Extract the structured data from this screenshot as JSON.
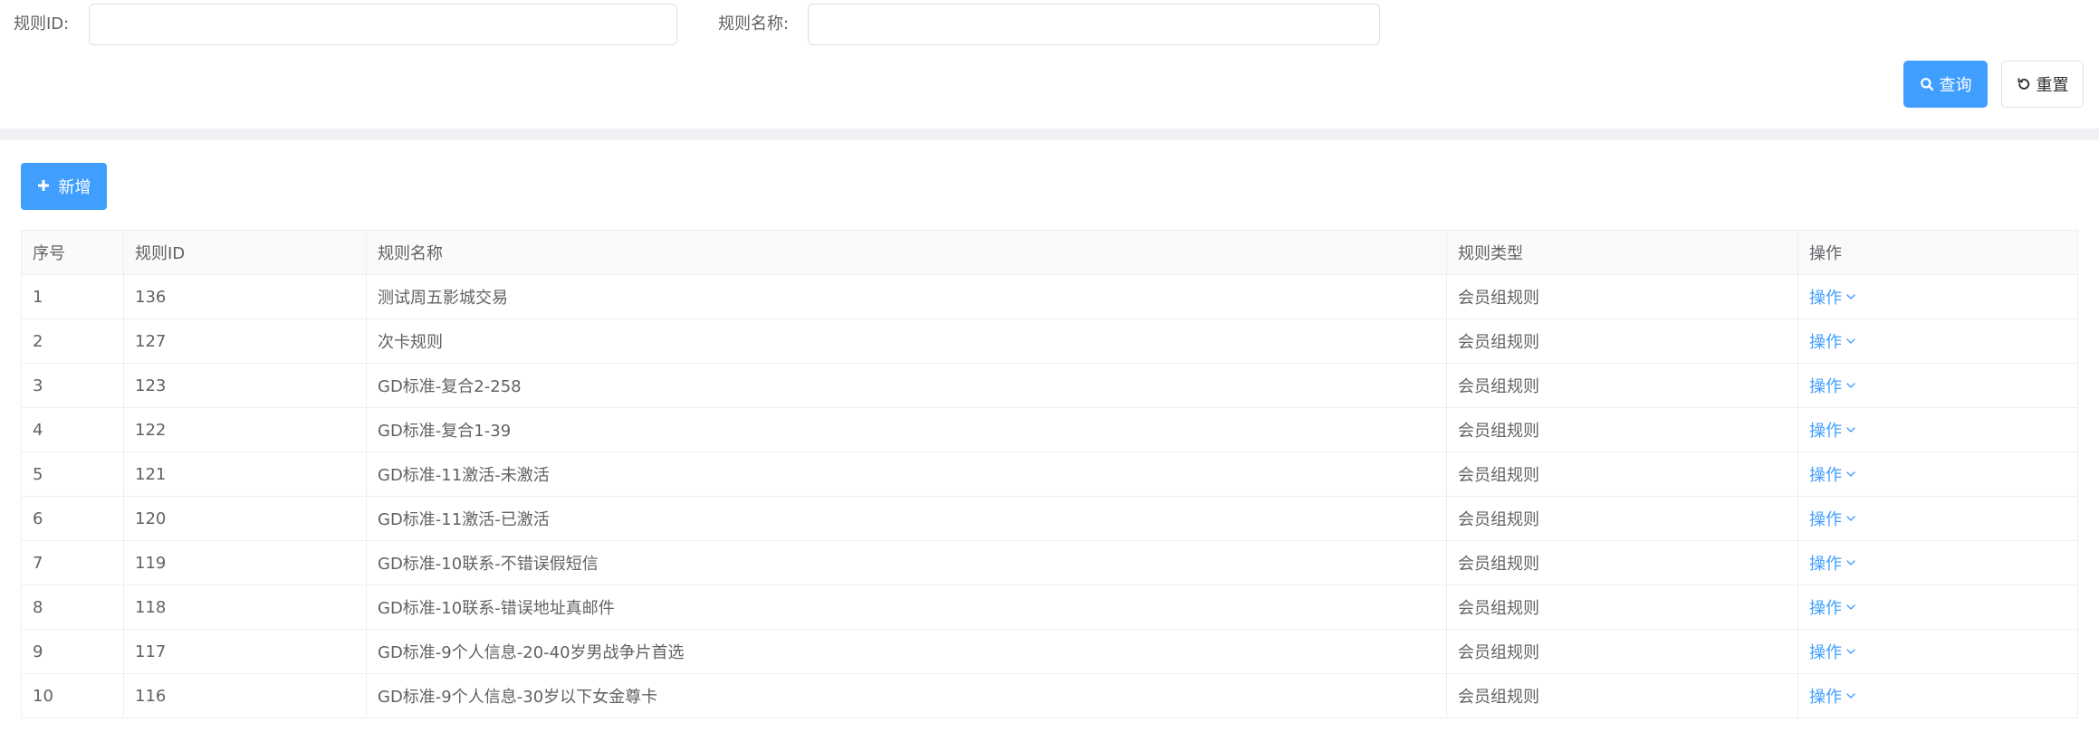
{
  "filters": {
    "rule_id_label": "规则ID:",
    "rule_id_value": "",
    "rule_name_label": "规则名称:",
    "rule_name_value": "",
    "search_label": "查询",
    "reset_label": "重置"
  },
  "toolbar": {
    "add_label": "新增"
  },
  "table": {
    "headers": {
      "index": "序号",
      "rule_id": "规则ID",
      "rule_name": "规则名称",
      "rule_type": "规则类型",
      "operation": "操作"
    },
    "rows": [
      {
        "index": "1",
        "rule_id": "136",
        "rule_name": "测试周五影城交易",
        "rule_type": "会员组规则",
        "operation": "操作"
      },
      {
        "index": "2",
        "rule_id": "127",
        "rule_name": "次卡规则",
        "rule_type": "会员组规则",
        "operation": "操作"
      },
      {
        "index": "3",
        "rule_id": "123",
        "rule_name": "GD标准-复合2-258",
        "rule_type": "会员组规则",
        "operation": "操作"
      },
      {
        "index": "4",
        "rule_id": "122",
        "rule_name": "GD标准-复合1-39",
        "rule_type": "会员组规则",
        "operation": "操作"
      },
      {
        "index": "5",
        "rule_id": "121",
        "rule_name": "GD标准-11激活-未激活",
        "rule_type": "会员组规则",
        "operation": "操作"
      },
      {
        "index": "6",
        "rule_id": "120",
        "rule_name": "GD标准-11激活-已激活",
        "rule_type": "会员组规则",
        "operation": "操作"
      },
      {
        "index": "7",
        "rule_id": "119",
        "rule_name": "GD标准-10联系-不错误假短信",
        "rule_type": "会员组规则",
        "operation": "操作"
      },
      {
        "index": "8",
        "rule_id": "118",
        "rule_name": "GD标准-10联系-错误地址真邮件",
        "rule_type": "会员组规则",
        "operation": "操作"
      },
      {
        "index": "9",
        "rule_id": "117",
        "rule_name": "GD标准-9个人信息-20-40岁男战争片首选",
        "rule_type": "会员组规则",
        "operation": "操作"
      },
      {
        "index": "10",
        "rule_id": "116",
        "rule_name": "GD标准-9个人信息-30岁以下女金尊卡",
        "rule_type": "会员组规则",
        "operation": "操作"
      }
    ]
  },
  "colors": {
    "primary": "#409eff",
    "text": "#606266",
    "border": "#ebeef5",
    "header_bg": "#fafafa",
    "divider": "#f0f2f5"
  },
  "icons": {
    "search": "search-icon",
    "reset": "refresh-icon",
    "add": "plus-icon",
    "dropdown": "chevron-down-icon"
  }
}
